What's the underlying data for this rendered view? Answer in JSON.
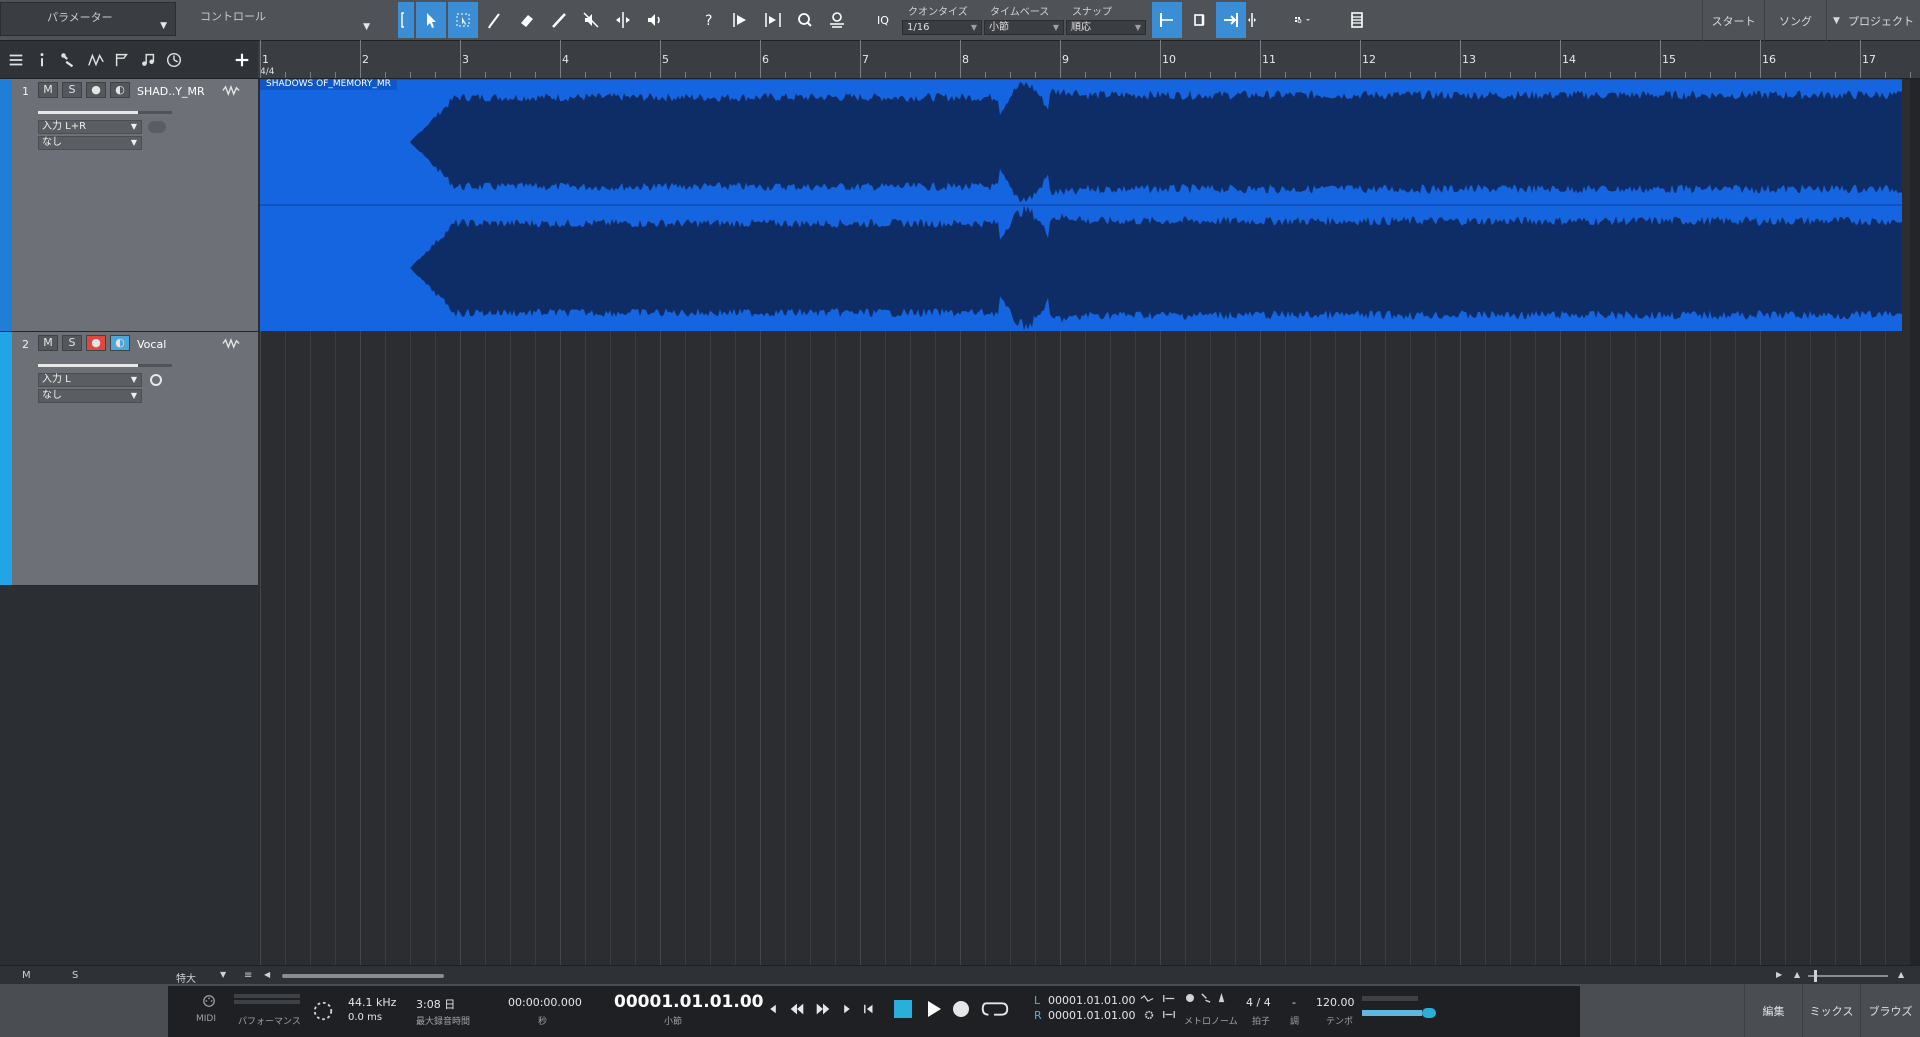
{
  "toolbar": {
    "parameter_label": "パラメーター",
    "control_label": "コントロール",
    "iq_label": "IQ",
    "quantize": {
      "title": "クオンタイズ",
      "value": "1/16"
    },
    "timebase": {
      "title": "タイムベース",
      "value": "小節"
    },
    "snap": {
      "title": "スナップ",
      "value": "順応"
    },
    "nav": {
      "start": "スタート",
      "song": "ソング",
      "project": "プロジェクト"
    }
  },
  "ruler": {
    "time_signature": "4/4",
    "bars": [
      "1",
      "2",
      "3",
      "4",
      "5",
      "6",
      "7",
      "8",
      "9",
      "10",
      "11",
      "12",
      "13",
      "14",
      "15",
      "16",
      "17"
    ]
  },
  "tracks": [
    {
      "number": "1",
      "name": "SHAD..Y_MR",
      "input": "入力 L+R",
      "output": "なし",
      "mute": "M",
      "solo": "S"
    },
    {
      "number": "2",
      "name": "Vocal",
      "input": "入力 L",
      "output": "なし",
      "mute": "M",
      "solo": "S"
    }
  ],
  "clip": {
    "name": "SHADOWS OF_MEMORY_MR",
    "color": "#1565e0"
  },
  "bottom": {
    "m": "M",
    "s": "S",
    "size": "特大"
  },
  "transport": {
    "midi_label": "MIDI",
    "performance_label": "パフォーマンス",
    "sample_rate": "44.1 kHz",
    "latency": "0.0 ms",
    "record_time": "3:08 日",
    "record_time_label": "最大録音時間",
    "seconds": "00:00:00.000",
    "seconds_label": "秒",
    "position": "00001.01.01.00",
    "position_label": "小節",
    "loop_left": "00001.01.01.00",
    "loop_right": "00001.01.01.00",
    "l_label": "L",
    "r_label": "R",
    "metronome_label": "メトロノーム",
    "time_sig": "4 / 4",
    "time_sig_label": "拍子",
    "key": "-",
    "key_label": "調",
    "tempo": "120.00",
    "tempo_label": "テンポ",
    "nav": {
      "edit": "編集",
      "mix": "ミックス",
      "browse": "ブラウズ"
    }
  }
}
